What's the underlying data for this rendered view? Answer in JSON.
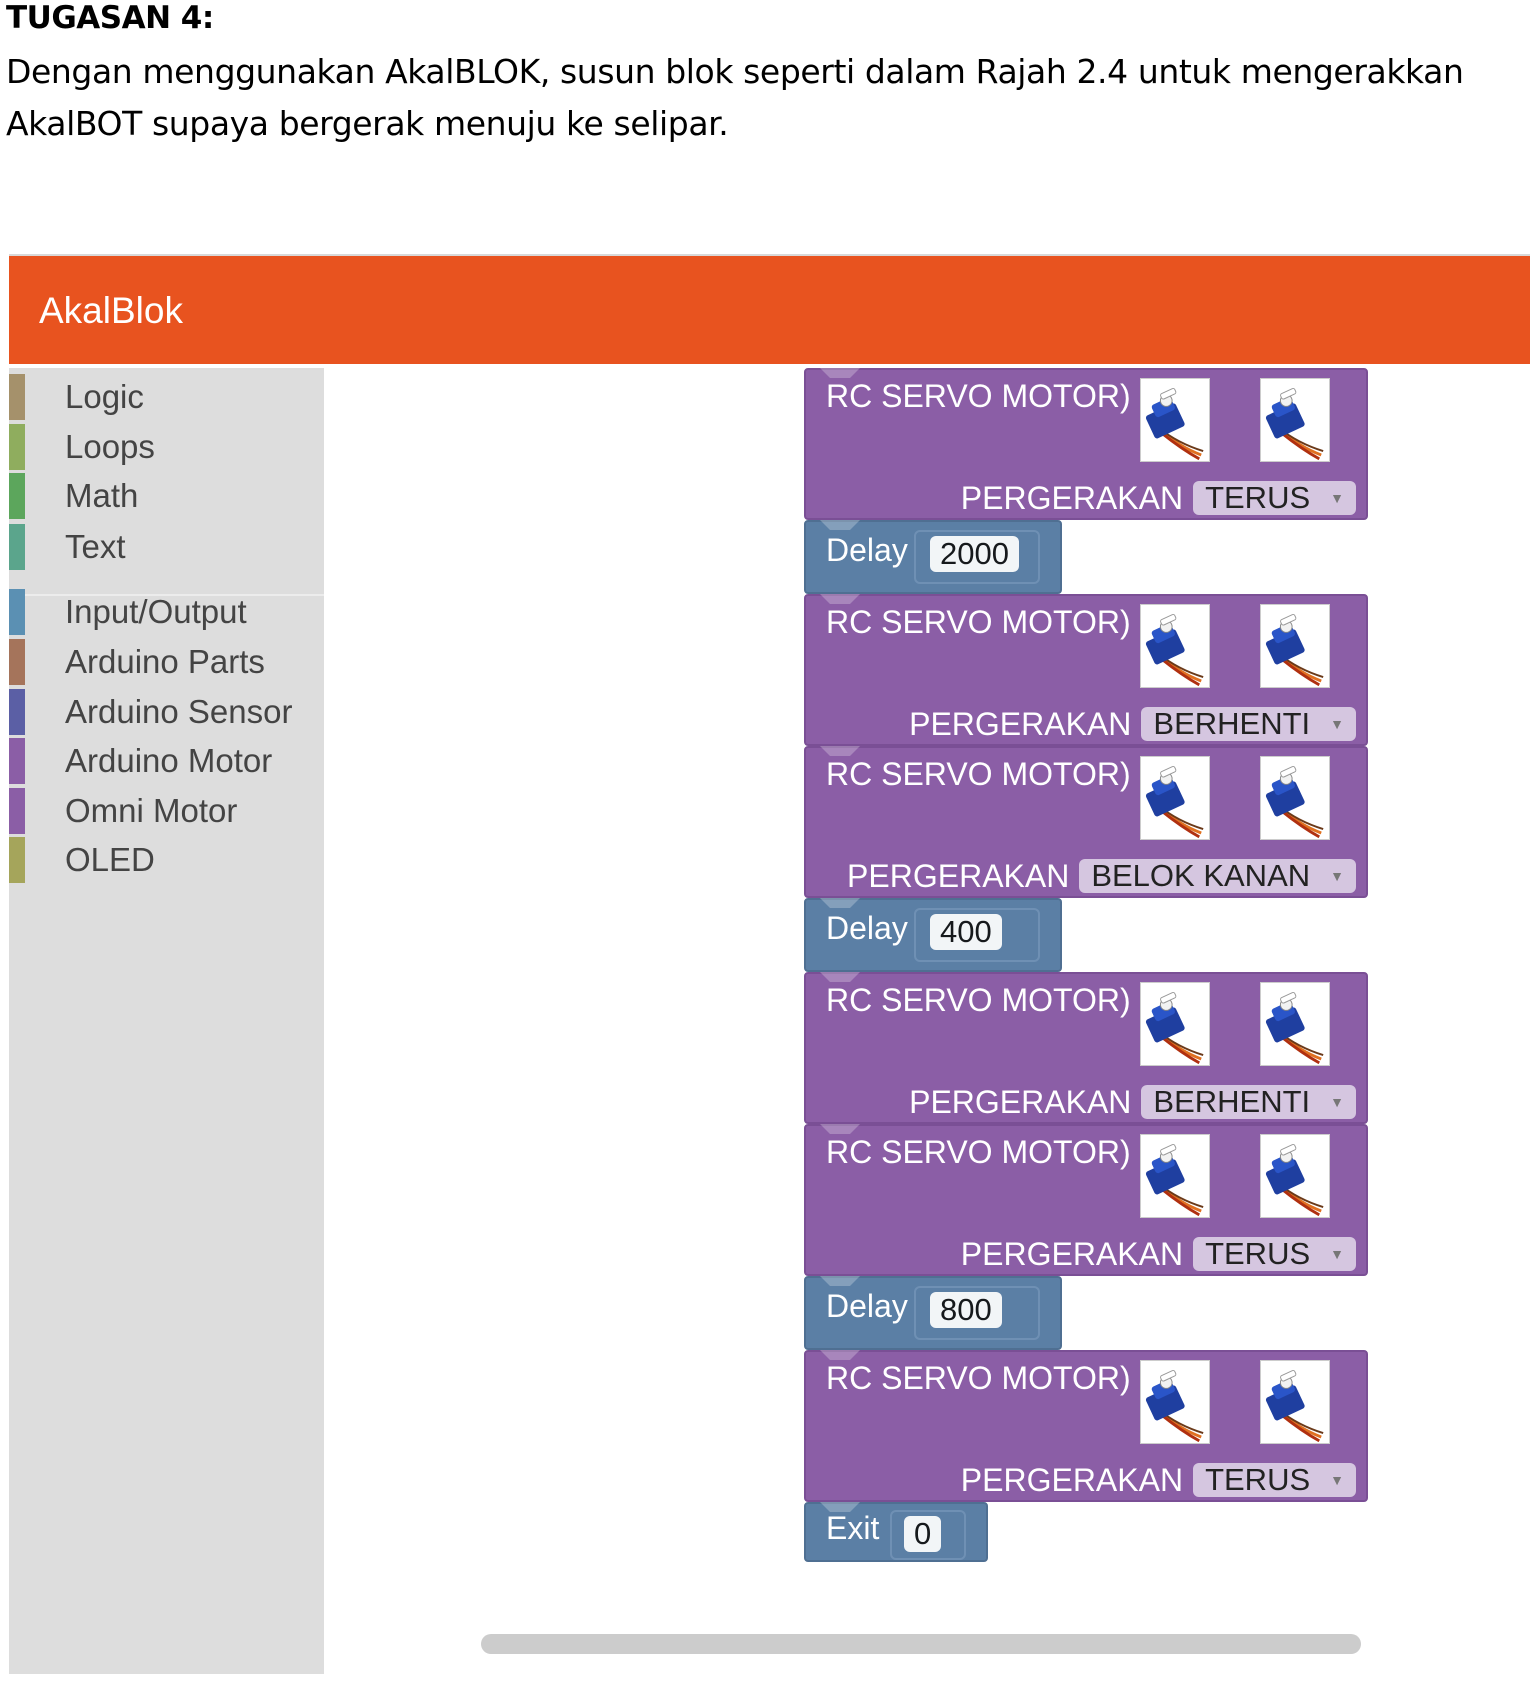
{
  "document": {
    "title": "TUGASAN 4:",
    "instruction": "Dengan menggunakan AkalBLOK, susun blok seperti dalam Rajah 2.4 untuk mengerakkan AkalBOT supaya bergerak menuju ke selipar."
  },
  "app": {
    "title": "AkalBlok",
    "header_color": "#e8531f"
  },
  "toolbox": {
    "categories": [
      {
        "label": "Logic",
        "color": "#a5916b"
      },
      {
        "label": "Loops",
        "color": "#8fad5e"
      },
      {
        "label": "Math",
        "color": "#5ca65c"
      },
      {
        "label": "Text",
        "color": "#5ba58c"
      },
      {
        "label": "Input/Output",
        "color": "#5b90b3"
      },
      {
        "label": "Arduino Parts",
        "color": "#a5745b"
      },
      {
        "label": "Arduino Sensor",
        "color": "#5b5fa5"
      },
      {
        "label": "Arduino Motor",
        "color": "#8b5ea6"
      },
      {
        "label": "Omni Motor",
        "color": "#8b5ea6"
      },
      {
        "label": "OLED",
        "color": "#a5a55b"
      }
    ]
  },
  "blocks": [
    {
      "type": "servo",
      "title": "RC SERVO MOTOR)",
      "param_label": "PERGERAKAN",
      "value": "TERUS",
      "icon": "servo-motor-icon"
    },
    {
      "type": "delay",
      "label": "Delay",
      "value": "2000"
    },
    {
      "type": "servo",
      "title": "RC SERVO MOTOR)",
      "param_label": "PERGERAKAN",
      "value": "BERHENTI",
      "icon": "servo-motor-icon"
    },
    {
      "type": "servo",
      "title": "RC SERVO MOTOR)",
      "param_label": "PERGERAKAN",
      "value": "BELOK KANAN",
      "icon": "servo-motor-icon"
    },
    {
      "type": "delay",
      "label": "Delay",
      "value": "400"
    },
    {
      "type": "servo",
      "title": "RC SERVO MOTOR)",
      "param_label": "PERGERAKAN",
      "value": "BERHENTI",
      "icon": "servo-motor-icon"
    },
    {
      "type": "servo",
      "title": "RC SERVO MOTOR)",
      "param_label": "PERGERAKAN",
      "value": "TERUS",
      "icon": "servo-motor-icon"
    },
    {
      "type": "delay",
      "label": "Delay",
      "value": "800"
    },
    {
      "type": "servo",
      "title": "RC SERVO MOTOR)",
      "param_label": "PERGERAKAN",
      "value": "TERUS",
      "icon": "servo-motor-icon"
    },
    {
      "type": "exit",
      "label": "Exit",
      "value": "0"
    }
  ],
  "colors": {
    "servo_block": "#8b5ea6",
    "delay_block": "#5b7fa5"
  }
}
